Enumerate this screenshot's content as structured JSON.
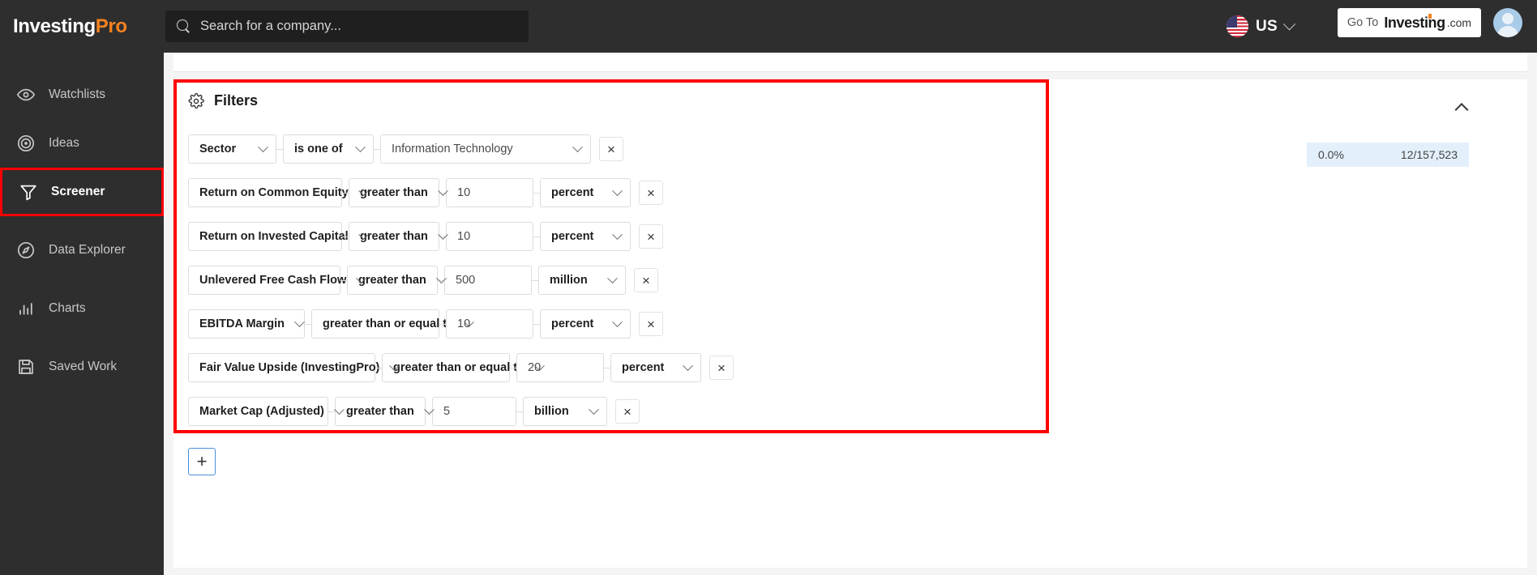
{
  "topbar": {
    "brand_first": "Investing",
    "brand_second": "Pro",
    "search": {
      "placeholder": "Search for a company..."
    },
    "region": {
      "label": "US",
      "flag": "us-flag-icon"
    },
    "goto": {
      "prefix": "Go To",
      "brand": "Investing",
      "tld": ".com"
    },
    "avatar_alt": "user-avatar"
  },
  "sidebar": {
    "items": [
      {
        "label": "Watchlists",
        "icon": "eye-icon",
        "active": false
      },
      {
        "label": "Ideas",
        "icon": "target-icon",
        "active": false
      },
      {
        "label": "Screener",
        "icon": "funnel-icon",
        "active": true
      },
      {
        "label": "Data Explorer",
        "icon": "compass-icon",
        "active": false
      },
      {
        "label": "Charts",
        "icon": "bar-chart-icon",
        "active": false
      },
      {
        "label": "Saved Work",
        "icon": "save-disk-icon",
        "active": false
      }
    ]
  },
  "panel": {
    "title": "Filters",
    "icon": "gear-icon",
    "collapse_icon": "chevron-up-icon",
    "add_filter_label": "+"
  },
  "counter": {
    "percent": "0.0%",
    "matches": "12/157,523"
  },
  "filters": [
    {
      "metric": "Sector",
      "operator": "is one of",
      "value": "Information Technology",
      "unit": null,
      "value_is_select": true,
      "remove_label": "×",
      "metric_w": 109,
      "operator_w": 112,
      "value_w": 260
    },
    {
      "metric": "Return on Common Equity",
      "operator": "greater than",
      "value": "10",
      "unit": "percent",
      "value_is_select": false,
      "remove_label": "×",
      "metric_w": 190,
      "operator_w": 112,
      "value_w": 108,
      "unit_w": 112
    },
    {
      "metric": "Return on Invested Capital",
      "operator": "greater than",
      "value": "10",
      "unit": "percent",
      "value_is_select": false,
      "remove_label": "×",
      "metric_w": 190,
      "operator_w": 112,
      "value_w": 108,
      "unit_w": 112
    },
    {
      "metric": "Unlevered Free Cash Flow",
      "operator": "greater than",
      "value": "500",
      "unit": "million",
      "value_is_select": false,
      "remove_label": "×",
      "metric_w": 188,
      "operator_w": 112,
      "value_w": 108,
      "unit_w": 108
    },
    {
      "metric": "EBITDA Margin",
      "operator": "greater than or equal to",
      "value": "10",
      "unit": "percent",
      "value_is_select": false,
      "remove_label": "×",
      "metric_w": 144,
      "operator_w": 158,
      "value_w": 108,
      "unit_w": 112
    },
    {
      "metric": "Fair Value Upside (InvestingPro)",
      "operator": "greater than or equal to",
      "value": "20",
      "unit": "percent",
      "value_is_select": false,
      "remove_label": "×",
      "metric_w": 231,
      "operator_w": 158,
      "value_w": 108,
      "unit_w": 112
    },
    {
      "metric": "Market Cap (Adjusted)",
      "operator": "greater than",
      "value": "5",
      "unit": "billion",
      "value_is_select": false,
      "remove_label": "×",
      "metric_w": 173,
      "operator_w": 112,
      "value_w": 104,
      "unit_w": 104
    }
  ],
  "colors": {
    "brand_orange": "#f58220",
    "highlight_red": "#ff0000",
    "topbar_bg": "#2e2e2e",
    "counter_bg": "#e3f0fb",
    "add_border": "#4a90d9"
  }
}
